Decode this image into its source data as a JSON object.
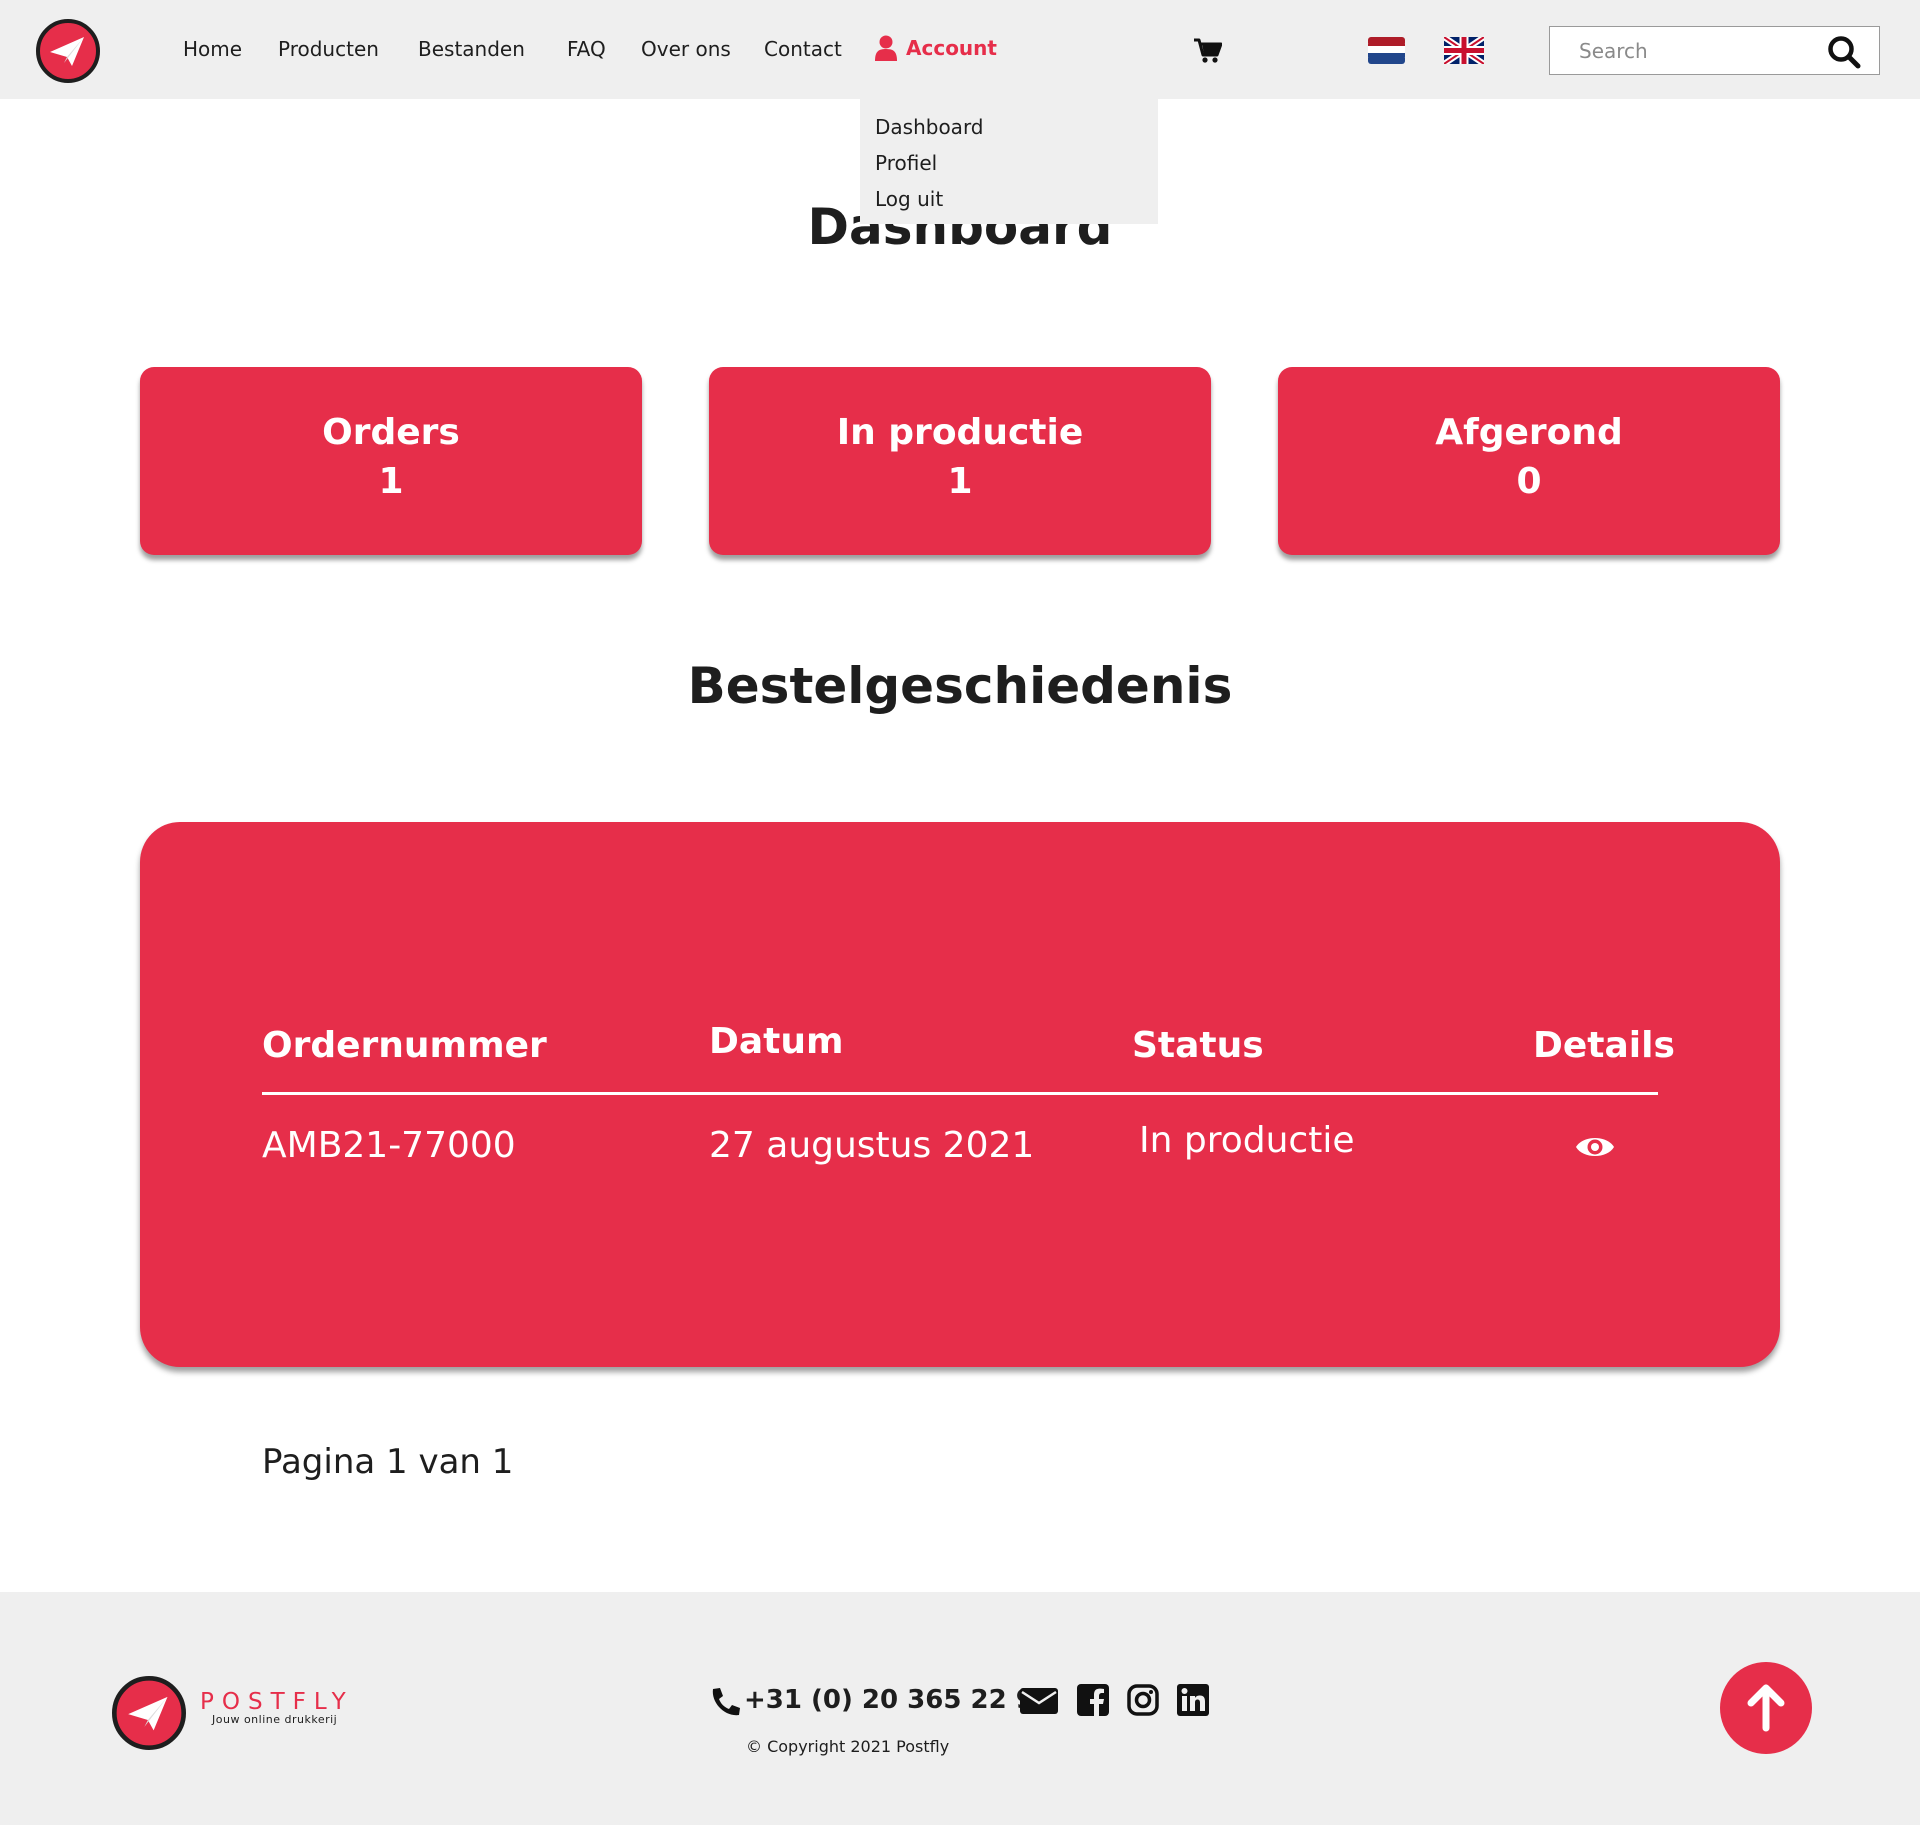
{
  "brand": {
    "accent_color": "#e62e4a",
    "name": "POSTFLY",
    "tagline": "Jouw online drukkerij"
  },
  "header": {
    "logo_icon": "paper-plane-icon",
    "nav": {
      "home": "Home",
      "producten": "Producten",
      "bestanden": "Bestanden",
      "faq": "FAQ",
      "over_ons": "Over ons",
      "contact": "Contact",
      "account": "Account"
    },
    "cart_icon": "cart-icon",
    "languages": [
      "nl",
      "en"
    ],
    "search": {
      "placeholder": "Search",
      "value": ""
    }
  },
  "account_menu": {
    "items": [
      "Dashboard",
      "Profiel",
      "Log uit"
    ]
  },
  "dashboard": {
    "title": "Dashboard",
    "stats": [
      {
        "label": "Orders",
        "value": "1"
      },
      {
        "label": "In productie",
        "value": "1"
      },
      {
        "label": "Afgerond",
        "value": "0"
      }
    ]
  },
  "history": {
    "title": "Bestelgeschiedenis",
    "columns": [
      "Ordernummer",
      "Datum",
      "Status",
      "Details"
    ],
    "rows": [
      {
        "order_number": "AMB21-77000",
        "date": "27 augustus 2021",
        "status": "In productie",
        "details_icon": "eye-icon"
      }
    ],
    "pagination": "Pagina 1 van 1"
  },
  "footer": {
    "phone": "+31 (0) 20 365 22 93",
    "copyright": "© Copyright 2021 Postfly",
    "social_icons": [
      "mail-icon",
      "facebook-icon",
      "instagram-icon",
      "linkedin-icon"
    ],
    "back_to_top_icon": "arrow-up-icon"
  }
}
